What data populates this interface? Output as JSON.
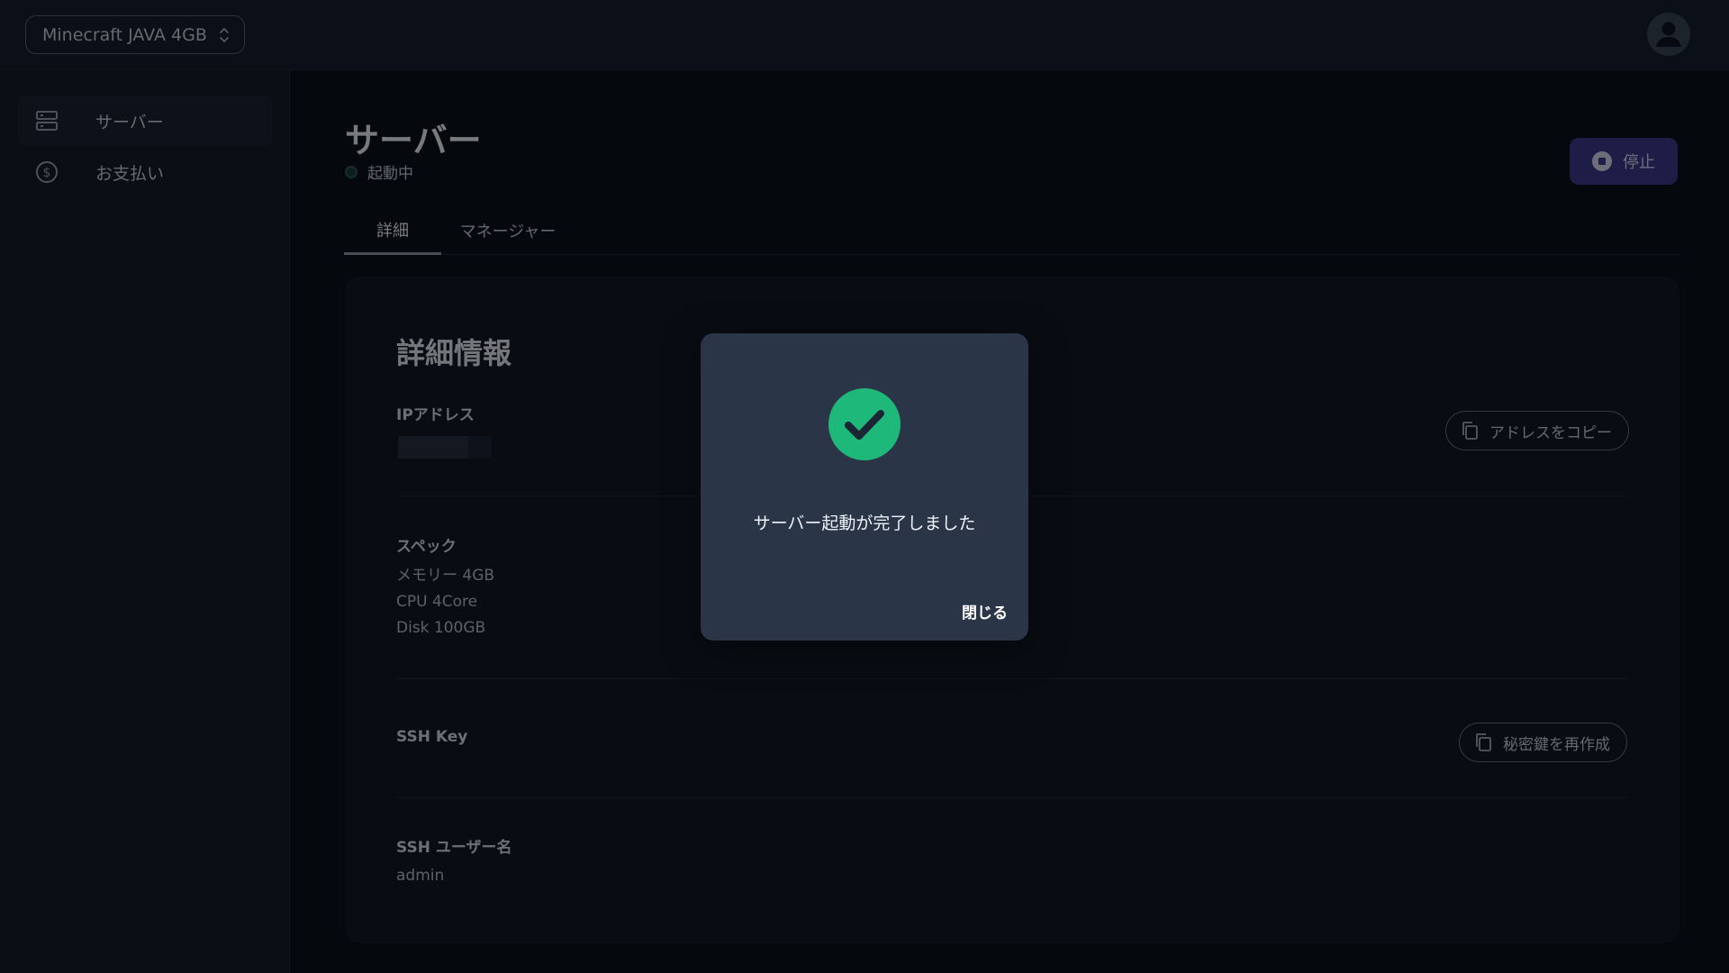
{
  "topbar": {
    "server_select": "Minecraft JAVA 4GB"
  },
  "sidebar": {
    "items": [
      {
        "label": "サーバー",
        "icon": "server-icon",
        "active": true
      },
      {
        "label": "お支払い",
        "icon": "dollar-icon",
        "active": false
      }
    ]
  },
  "main": {
    "title": "サーバー",
    "status": "起動中",
    "stop_label": "停止",
    "tabs": [
      {
        "label": "詳細",
        "active": true
      },
      {
        "label": "マネージャー",
        "active": false
      }
    ],
    "card": {
      "title": "詳細情報",
      "ip_label": "IPアドレス",
      "copy_address_label": "アドレスをコピー",
      "spec_label": "スペック",
      "spec_memory": "メモリー 4GB",
      "spec_cpu": "CPU 4Core",
      "spec_disk": "Disk 100GB",
      "ssh_key_label": "SSH Key",
      "regen_key_label": "秘密鍵を再作成",
      "ssh_user_label": "SSH ユーザー名",
      "ssh_user_value": "admin"
    }
  },
  "dialog": {
    "message": "サーバー起動が完了しました",
    "close_label": "閉じる",
    "icon": "check-circle-icon"
  },
  "colors": {
    "accent_success": "#1eb87a",
    "stop_button": "#3c3a8e",
    "dialog_bg": "#2a3648"
  }
}
